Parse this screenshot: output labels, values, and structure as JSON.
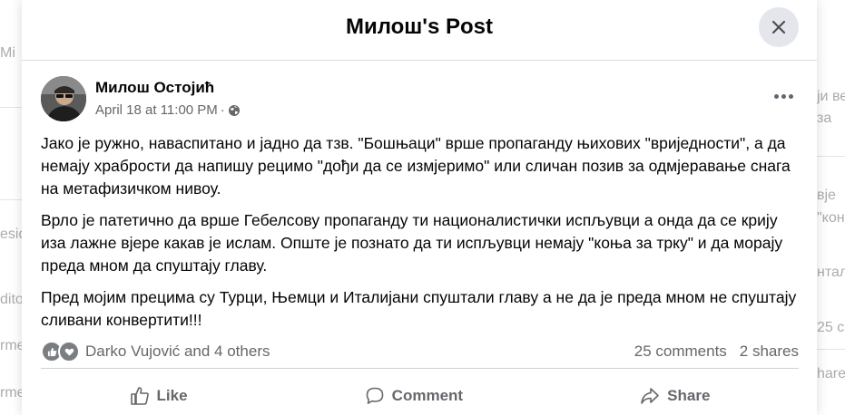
{
  "background": {
    "left_fragments": [
      "Mi",
      "esid",
      "dito",
      "rme",
      "rme"
    ],
    "right_fragments": [
      "ји ве",
      "за",
      "вје",
      "\"кон",
      "нтали",
      "25 c",
      "hare"
    ]
  },
  "modal": {
    "title": "Милош's Post",
    "close_icon": "close-icon"
  },
  "post": {
    "author": "Милош Остојић",
    "timestamp": "April 18 at 11:00 PM",
    "separator": "·",
    "privacy_icon": "globe-icon",
    "paragraphs": [
      "Јако је ружно, наваспитано и јадно да тзв. \"Бошњаци\" врше пропаганду њихових \"вриједности\", а да немају храбрости да напишу рецимо \"дођи да се измјеримо\" или сличан позив за одмјеравање снага на метафизичком нивоу.",
      "Врло је патетично да врше Гебелсову пропаганду ти националистички испљувци а онда да се крију иза лажне вјере какав је ислам. Опште је познато да ти испљувци немају \"коња за трку\" и да морају преда мном да спуштају главу.",
      "Пред мојим прецима су Турци, Њемци и Италијани спуштали главу а не да је преда мном  не спуштају сливани конвертити!!!"
    ],
    "reactions": {
      "names": "Darko Vujović and 4 others",
      "comments": "25 comments",
      "shares": "2 shares"
    },
    "actions": {
      "like": "Like",
      "comment": "Comment",
      "share": "Share"
    }
  }
}
